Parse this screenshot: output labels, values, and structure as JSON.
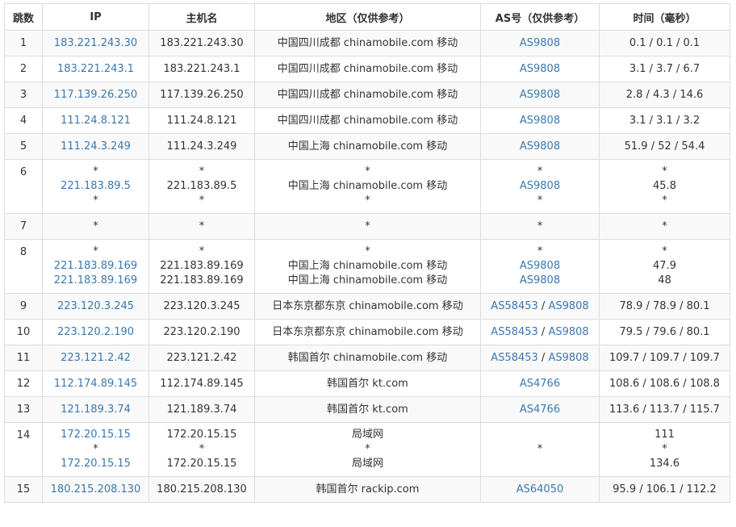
{
  "headers": {
    "hop": "跳数",
    "ip": "IP",
    "hostname": "主机名",
    "region": "地区（仅供参考）",
    "asn": "AS号（仅供参考）",
    "time": "时间（毫秒）"
  },
  "rows": [
    {
      "hop": "1",
      "ip": [
        "183.221.243.30"
      ],
      "host": [
        "183.221.243.30"
      ],
      "region": [
        "中国四川成都 chinamobile.com 移动"
      ],
      "as": [
        [
          "AS9808"
        ]
      ],
      "time": [
        "0.1 / 0.1 / 0.1"
      ]
    },
    {
      "hop": "2",
      "ip": [
        "183.221.243.1"
      ],
      "host": [
        "183.221.243.1"
      ],
      "region": [
        "中国四川成都 chinamobile.com 移动"
      ],
      "as": [
        [
          "AS9808"
        ]
      ],
      "time": [
        "3.1 / 3.7 / 6.7"
      ]
    },
    {
      "hop": "3",
      "ip": [
        "117.139.26.250"
      ],
      "host": [
        "117.139.26.250"
      ],
      "region": [
        "中国四川成都 chinamobile.com 移动"
      ],
      "as": [
        [
          "AS9808"
        ]
      ],
      "time": [
        "2.8 / 4.3 / 14.6"
      ]
    },
    {
      "hop": "4",
      "ip": [
        "111.24.8.121"
      ],
      "host": [
        "111.24.8.121"
      ],
      "region": [
        "中国四川成都 chinamobile.com 移动"
      ],
      "as": [
        [
          "AS9808"
        ]
      ],
      "time": [
        "3.1 / 3.1 / 3.2"
      ]
    },
    {
      "hop": "5",
      "ip": [
        "111.24.3.249"
      ],
      "host": [
        "111.24.3.249"
      ],
      "region": [
        "中国上海 chinamobile.com 移动"
      ],
      "as": [
        [
          "AS9808"
        ]
      ],
      "time": [
        "51.9 / 52 / 54.4"
      ]
    },
    {
      "hop": "6",
      "ip": [
        "*",
        "221.183.89.5",
        "*"
      ],
      "host": [
        "*",
        "221.183.89.5",
        "*"
      ],
      "region": [
        "*",
        "中国上海 chinamobile.com 移动",
        "*"
      ],
      "as": [
        [
          "*"
        ],
        [
          "AS9808"
        ],
        [
          "*"
        ]
      ],
      "time": [
        "*",
        "45.8",
        "*"
      ]
    },
    {
      "hop": "7",
      "ip": [
        "*"
      ],
      "host": [
        "*"
      ],
      "region": [
        "*"
      ],
      "as": [
        [
          "*"
        ]
      ],
      "time": [
        "*"
      ]
    },
    {
      "hop": "8",
      "ip": [
        "*",
        "221.183.89.169",
        "221.183.89.169"
      ],
      "host": [
        "*",
        "221.183.89.169",
        "221.183.89.169"
      ],
      "region": [
        "*",
        "中国上海 chinamobile.com 移动",
        "中国上海 chinamobile.com 移动"
      ],
      "as": [
        [
          "*"
        ],
        [
          "AS9808"
        ],
        [
          "AS9808"
        ]
      ],
      "time": [
        "*",
        "47.9",
        "48"
      ]
    },
    {
      "hop": "9",
      "ip": [
        "223.120.3.245"
      ],
      "host": [
        "223.120.3.245"
      ],
      "region": [
        "日本东京都东京 chinamobile.com 移动"
      ],
      "as": [
        [
          "AS58453",
          "AS9808"
        ]
      ],
      "time": [
        "78.9 / 78.9 / 80.1"
      ]
    },
    {
      "hop": "10",
      "ip": [
        "223.120.2.190"
      ],
      "host": [
        "223.120.2.190"
      ],
      "region": [
        "日本东京都东京 chinamobile.com 移动"
      ],
      "as": [
        [
          "AS58453",
          "AS9808"
        ]
      ],
      "time": [
        "79.5 / 79.6 / 80.1"
      ]
    },
    {
      "hop": "11",
      "ip": [
        "223.121.2.42"
      ],
      "host": [
        "223.121.2.42"
      ],
      "region": [
        "韩国首尔 chinamobile.com 移动"
      ],
      "as": [
        [
          "AS58453",
          "AS9808"
        ]
      ],
      "time": [
        "109.7 / 109.7 / 109.7"
      ]
    },
    {
      "hop": "12",
      "ip": [
        "112.174.89.145"
      ],
      "host": [
        "112.174.89.145"
      ],
      "region": [
        "韩国首尔 kt.com"
      ],
      "as": [
        [
          "AS4766"
        ]
      ],
      "time": [
        "108.6 / 108.6 / 108.8"
      ]
    },
    {
      "hop": "13",
      "ip": [
        "121.189.3.74"
      ],
      "host": [
        "121.189.3.74"
      ],
      "region": [
        "韩国首尔 kt.com"
      ],
      "as": [
        [
          "AS4766"
        ]
      ],
      "time": [
        "113.6 / 113.7 / 115.7"
      ]
    },
    {
      "hop": "14",
      "ip": [
        "172.20.15.15",
        "*",
        "172.20.15.15"
      ],
      "host": [
        "172.20.15.15",
        "*",
        "172.20.15.15"
      ],
      "region": [
        "局域网",
        "*",
        "局域网"
      ],
      "as": [
        [
          "*"
        ]
      ],
      "time": [
        "111",
        "*",
        "134.6"
      ]
    },
    {
      "hop": "15",
      "ip": [
        "180.215.208.130"
      ],
      "host": [
        "180.215.208.130"
      ],
      "region": [
        "韩国首尔 rackip.com"
      ],
      "as": [
        [
          "AS64050"
        ]
      ],
      "time": [
        "95.9 / 106.1 / 112.2"
      ]
    }
  ],
  "as_separator": " / ",
  "colors": {
    "link": "#3a78b0",
    "border": "#dddddd",
    "stripe": "#f9f9f9"
  }
}
